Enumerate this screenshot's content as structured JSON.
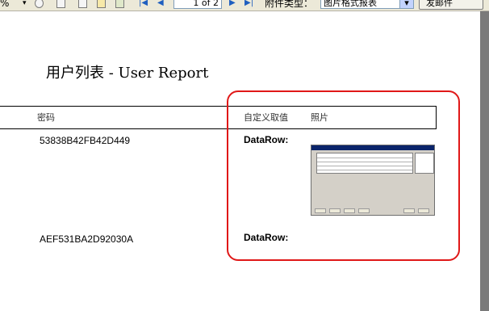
{
  "toolbar": {
    "zoom_value": "%",
    "page_indicator": "1 of 2",
    "attachment_type_label": "附件类型：",
    "attachment_type_value": "图片格式报表",
    "send_email_label": "发邮件"
  },
  "report": {
    "title": "用户列表 - User Report",
    "columns": {
      "password": "密码",
      "custom_value": "自定义取值",
      "photo": "照片"
    },
    "rows": [
      {
        "password": "53838B42FB42D449",
        "custom_value": "DataRow:"
      },
      {
        "password": "AEF531BA2D92030A",
        "custom_value": "DataRow:"
      }
    ]
  },
  "colors": {
    "highlight": "#e01818",
    "toolbar_bg": "#ece9d8",
    "viewer_bg": "#808080"
  }
}
